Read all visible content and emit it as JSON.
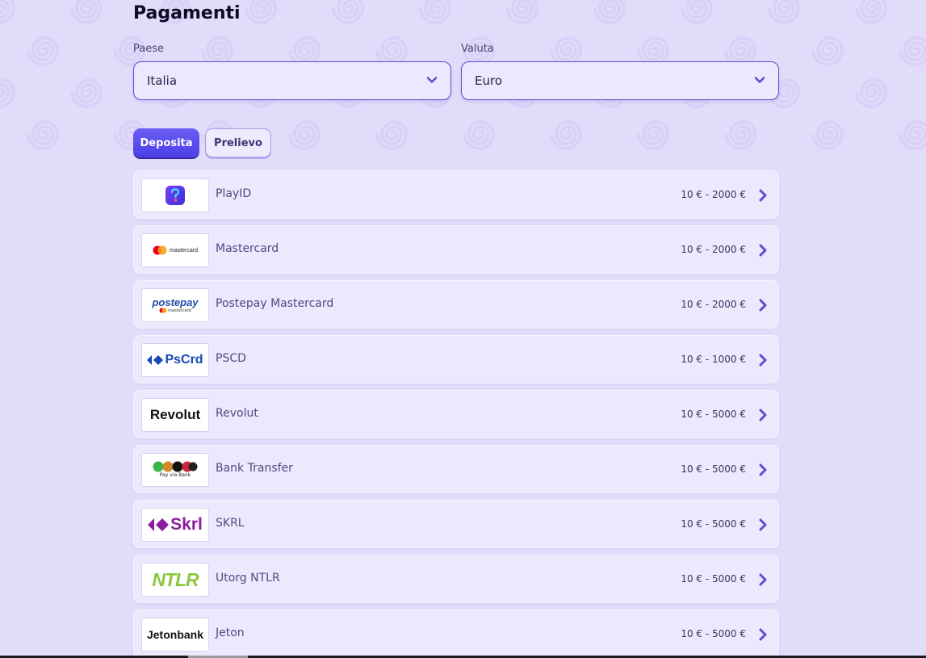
{
  "page": {
    "title": "Pagamenti"
  },
  "filters": {
    "country": {
      "label": "Paese",
      "value": "Italia"
    },
    "currency": {
      "label": "Valuta",
      "value": "Euro"
    }
  },
  "tabs": [
    {
      "label": "Deposita",
      "active": true
    },
    {
      "label": "Prelievo",
      "active": false
    }
  ],
  "methods": [
    {
      "name": "PlayID",
      "range": "10 € - 2000 €",
      "logo": "playid-logo"
    },
    {
      "name": "Mastercard",
      "range": "10 € - 2000 €",
      "logo": "mastercard-logo",
      "logo_text": "mastercard"
    },
    {
      "name": "Postepay Mastercard",
      "range": "10 € - 2000 €",
      "logo": "postepay-logo",
      "logo_text": "postepay",
      "logo_subtext": "mastercard"
    },
    {
      "name": "PSCD",
      "range": "10 € - 1000 €",
      "logo": "pscrd-logo",
      "logo_text": "PsCrd"
    },
    {
      "name": "Revolut",
      "range": "10 € - 5000 €",
      "logo": "revolut-logo",
      "logo_text": "Revolut"
    },
    {
      "name": "Bank Transfer",
      "range": "10 € - 5000 €",
      "logo": "bank-transfer-logo",
      "logo_text": "Pay via Bank"
    },
    {
      "name": "SKRL",
      "range": "10 € - 5000 €",
      "logo": "skrl-logo",
      "logo_text": "Skrl"
    },
    {
      "name": "Utorg NTLR",
      "range": "10 € - 5000 €",
      "logo": "ntlr-logo",
      "logo_text": "NTLR"
    },
    {
      "name": "Jeton",
      "range": "10 € - 5000 €",
      "logo": "jetonbank-logo",
      "logo_text": "Jetonbank"
    }
  ],
  "colors": {
    "background": "#e2dcfb",
    "accent": "#5b4fcf",
    "card": "#ece8fd",
    "arrow": "#5b4fcf"
  }
}
